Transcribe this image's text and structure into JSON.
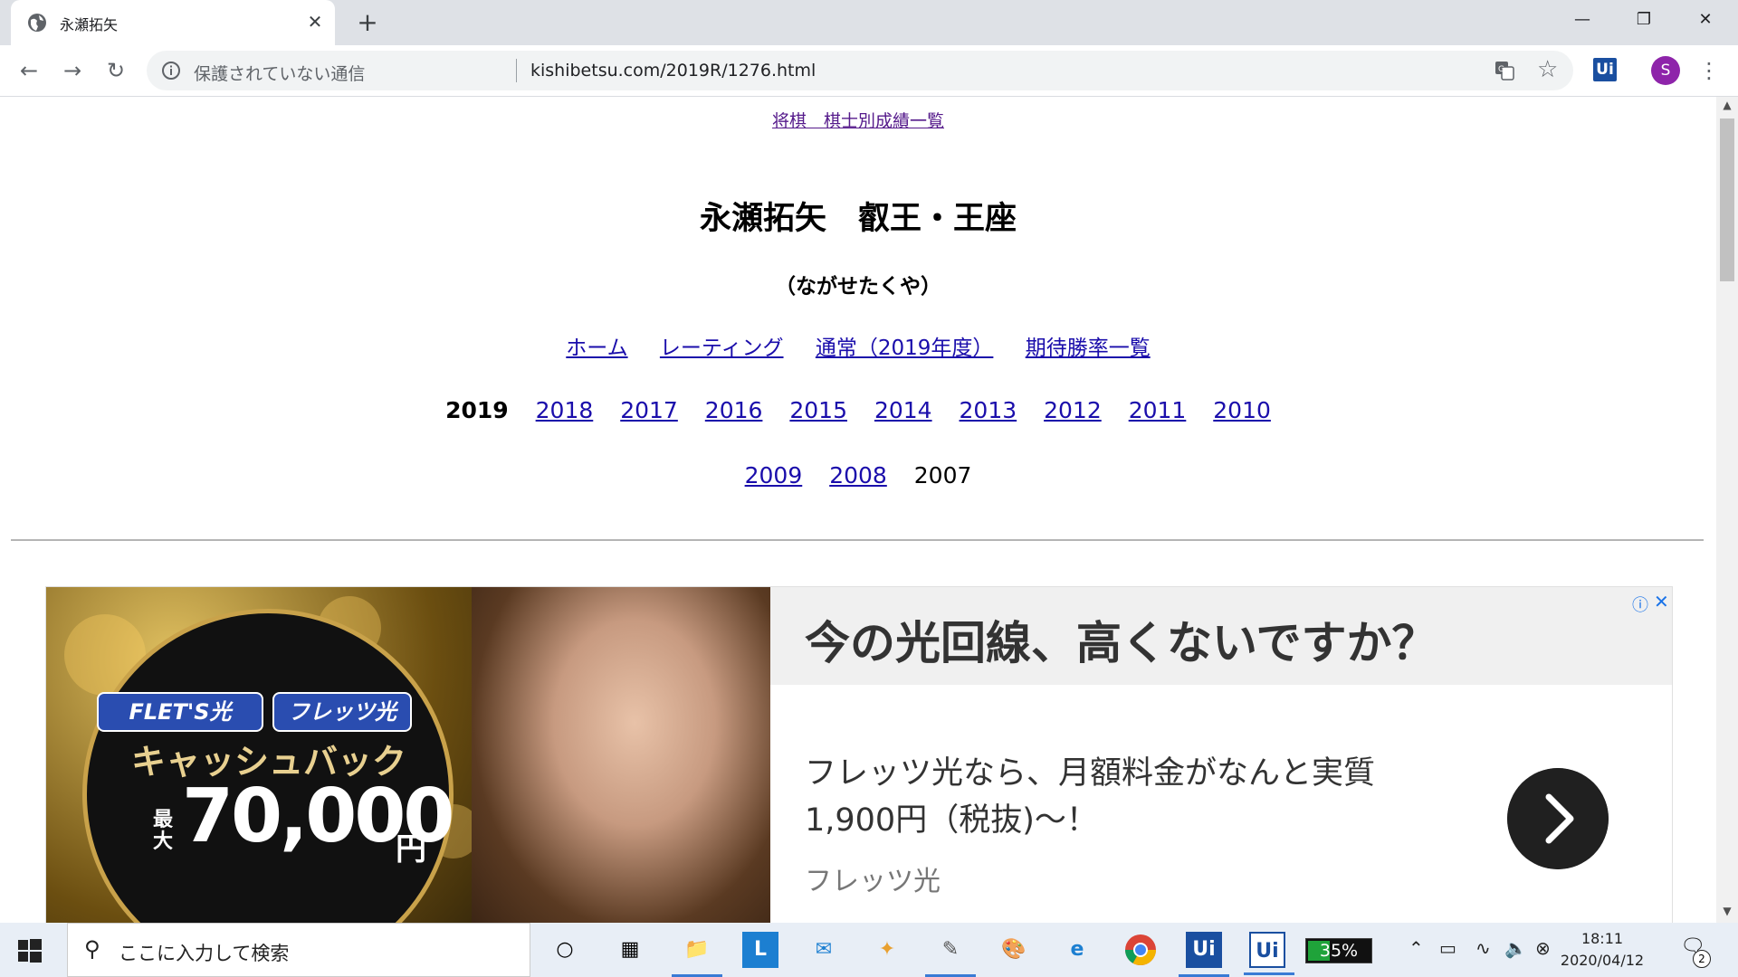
{
  "browser": {
    "tab_title": "永瀬拓矢",
    "new_tab_label": "+",
    "security_label": "保護されていない通信",
    "url": "kishibetsu.com/2019R/1276.html",
    "profile_initial": "S",
    "ext_label": "Ui"
  },
  "page": {
    "top_link": "将棋　棋士別成績一覧",
    "heading": "永瀬拓矢　叡王・王座",
    "reading": "（ながせたくや）",
    "nav_links": [
      "ホーム",
      "レーティング",
      "通常（2019年度）",
      "期待勝率一覧"
    ],
    "years_row1": [
      "2019",
      "2018",
      "2017",
      "2016",
      "2015",
      "2014",
      "2013",
      "2012",
      "2011",
      "2010"
    ],
    "years_row2": [
      "2009",
      "2008",
      "2007"
    ],
    "current_year": "2019"
  },
  "ad": {
    "pill1": "FLET'S光",
    "pill2": "フレッツ光",
    "cashback": "キャッシュバック",
    "max_label": "最大",
    "amount": "70,000",
    "yen": "円",
    "headline": "今の光回線、高くないですか？",
    "body_line1": "フレッツ光なら、月額料金がなんと実質",
    "body_line2": "1,900円（税抜)～！",
    "brand": "フレッツ光"
  },
  "taskbar": {
    "search_placeholder": "ここに入力して検索",
    "battery_app_percent": "35%",
    "battery_app_level": 0.35,
    "time": "18:11",
    "date": "2020/04/12",
    "notification_count": "2"
  }
}
